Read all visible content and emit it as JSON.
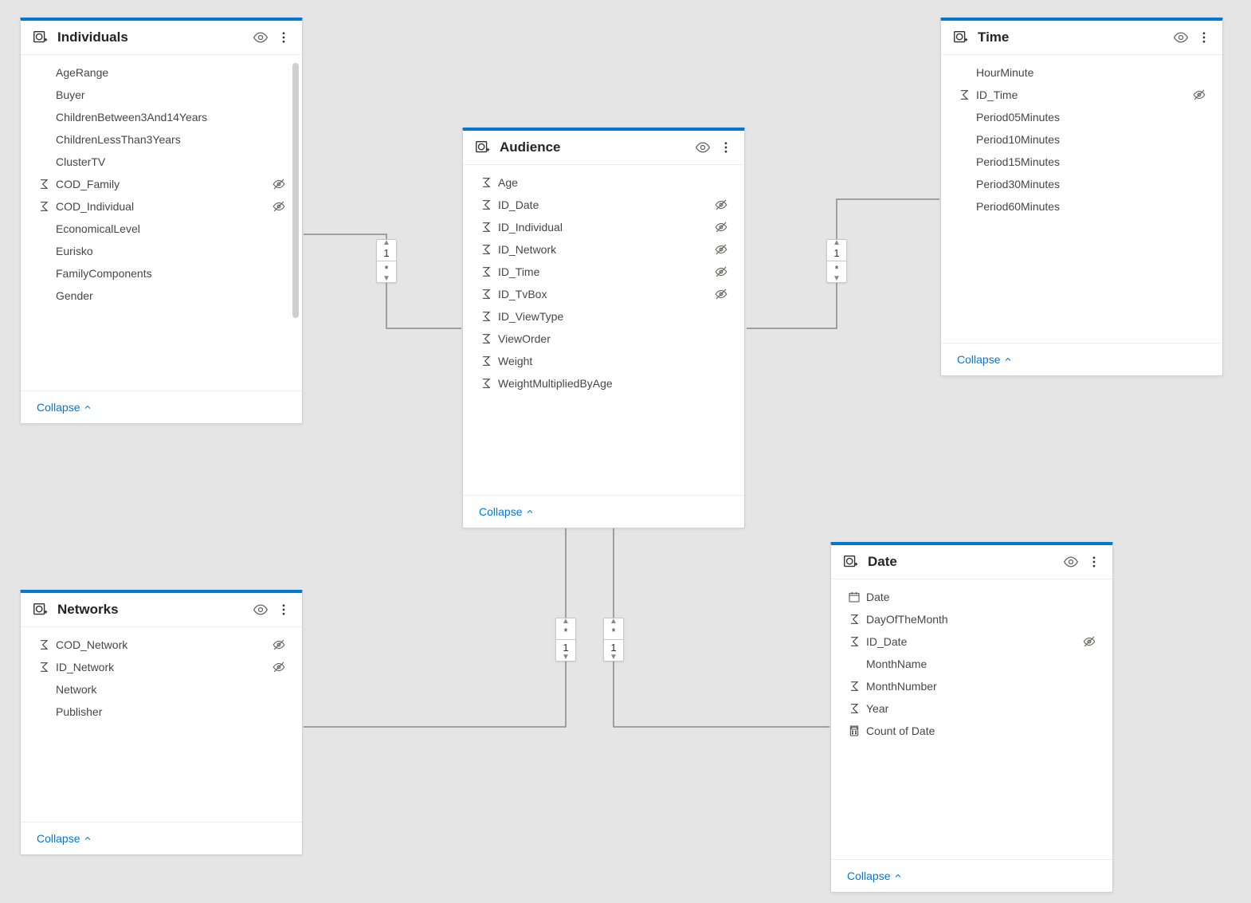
{
  "collapse_label": "Collapse",
  "tables": {
    "individuals": {
      "title": "Individuals",
      "fields": [
        {
          "icon": "",
          "name": "AgeRange",
          "hidden": false
        },
        {
          "icon": "",
          "name": "Buyer",
          "hidden": false
        },
        {
          "icon": "",
          "name": "ChildrenBetween3And14Years",
          "hidden": false
        },
        {
          "icon": "",
          "name": "ChildrenLessThan3Years",
          "hidden": false
        },
        {
          "icon": "",
          "name": "ClusterTV",
          "hidden": false
        },
        {
          "icon": "sum",
          "name": "COD_Family",
          "hidden": true
        },
        {
          "icon": "sum",
          "name": "COD_Individual",
          "hidden": true
        },
        {
          "icon": "",
          "name": "EconomicalLevel",
          "hidden": false
        },
        {
          "icon": "",
          "name": "Eurisko",
          "hidden": false
        },
        {
          "icon": "",
          "name": "FamilyComponents",
          "hidden": false
        },
        {
          "icon": "",
          "name": "Gender",
          "hidden": false
        }
      ]
    },
    "audience": {
      "title": "Audience",
      "fields": [
        {
          "icon": "sum",
          "name": "Age",
          "hidden": false
        },
        {
          "icon": "sum",
          "name": "ID_Date",
          "hidden": true
        },
        {
          "icon": "sum",
          "name": "ID_Individual",
          "hidden": true
        },
        {
          "icon": "sum",
          "name": "ID_Network",
          "hidden": true
        },
        {
          "icon": "sum",
          "name": "ID_Time",
          "hidden": true
        },
        {
          "icon": "sum",
          "name": "ID_TvBox",
          "hidden": true
        },
        {
          "icon": "sum",
          "name": "ID_ViewType",
          "hidden": false
        },
        {
          "icon": "sum",
          "name": "ViewOrder",
          "hidden": false
        },
        {
          "icon": "sum",
          "name": "Weight",
          "hidden": false
        },
        {
          "icon": "sum",
          "name": "WeightMultipliedByAge",
          "hidden": false
        }
      ]
    },
    "time": {
      "title": "Time",
      "fields": [
        {
          "icon": "",
          "name": "HourMinute",
          "hidden": false
        },
        {
          "icon": "sum",
          "name": "ID_Time",
          "hidden": true
        },
        {
          "icon": "",
          "name": "Period05Minutes",
          "hidden": false
        },
        {
          "icon": "",
          "name": "Period10Minutes",
          "hidden": false
        },
        {
          "icon": "",
          "name": "Period15Minutes",
          "hidden": false
        },
        {
          "icon": "",
          "name": "Period30Minutes",
          "hidden": false
        },
        {
          "icon": "",
          "name": "Period60Minutes",
          "hidden": false
        }
      ]
    },
    "networks": {
      "title": "Networks",
      "fields": [
        {
          "icon": "sum",
          "name": "COD_Network",
          "hidden": true
        },
        {
          "icon": "sum",
          "name": "ID_Network",
          "hidden": true
        },
        {
          "icon": "",
          "name": "Network",
          "hidden": false
        },
        {
          "icon": "",
          "name": "Publisher",
          "hidden": false
        }
      ]
    },
    "date": {
      "title": "Date",
      "fields": [
        {
          "icon": "date",
          "name": "Date",
          "hidden": false
        },
        {
          "icon": "sum",
          "name": "DayOfTheMonth",
          "hidden": false
        },
        {
          "icon": "sum",
          "name": "ID_Date",
          "hidden": true
        },
        {
          "icon": "",
          "name": "MonthName",
          "hidden": false
        },
        {
          "icon": "sum",
          "name": "MonthNumber",
          "hidden": false
        },
        {
          "icon": "sum",
          "name": "Year",
          "hidden": false
        },
        {
          "icon": "calc",
          "name": "Count of Date",
          "hidden": false
        }
      ]
    }
  },
  "relationships": [
    {
      "from": "individuals",
      "to": "audience",
      "from_card": "1",
      "to_card": "*"
    },
    {
      "from": "time",
      "to": "audience",
      "from_card": "1",
      "to_card": "*"
    },
    {
      "from": "networks",
      "to": "audience",
      "from_card": "1",
      "to_card": "*"
    },
    {
      "from": "date",
      "to": "audience",
      "from_card": "1",
      "to_card": "*"
    }
  ]
}
